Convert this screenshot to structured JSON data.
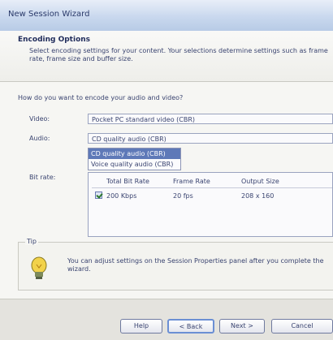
{
  "window": {
    "title": "New Session Wizard"
  },
  "header": {
    "title": "Encoding Options",
    "description": "Select encoding settings for your content. Your selections determine settings such as frame rate, frame size and buffer size."
  },
  "question": "How do you want to encode your audio and video?",
  "form": {
    "video_label": "Video:",
    "video_value": "Pocket PC standard video (CBR)",
    "audio_label": "Audio:",
    "audio_value": "CD quality audio (CBR)",
    "audio_options": [
      "CD quality audio (CBR)",
      "Voice quality audio (CBR)"
    ],
    "bitrate_label": "Bit rate:"
  },
  "bitrate_table": {
    "columns": [
      "Total Bit Rate",
      "Frame Rate",
      "Output Size"
    ],
    "rows": [
      {
        "checked": true,
        "bit_rate": "200 Kbps",
        "frame_rate": "20 fps",
        "output_size": "208 x 160"
      }
    ]
  },
  "tip": {
    "title": "Tip",
    "text": "You can adjust settings on the Session Properties panel after you complete the wizard."
  },
  "footer": {
    "help_label": "Help",
    "back_label": "< Back",
    "next_label": "Next >",
    "cancel_label": "Cancel"
  },
  "colors": {
    "selection": "#5e79b8",
    "title_gradient_top": "#e8eef8",
    "title_gradient_bottom": "#b8cbe6"
  }
}
